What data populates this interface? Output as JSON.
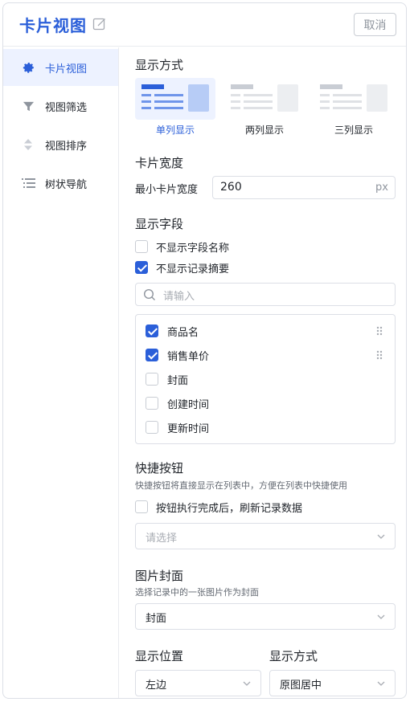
{
  "header": {
    "title": "卡片视图",
    "cancel_label": "取消"
  },
  "sidebar": {
    "items": [
      {
        "label": "卡片视图",
        "icon": "gear-icon",
        "active": true
      },
      {
        "label": "视图筛选",
        "icon": "filter-icon",
        "active": false
      },
      {
        "label": "视图排序",
        "icon": "sort-icon",
        "active": false
      },
      {
        "label": "树状导航",
        "icon": "tree-list-icon",
        "active": false
      }
    ]
  },
  "display_mode": {
    "title": "显示方式",
    "options": [
      {
        "label": "单列显示",
        "selected": true
      },
      {
        "label": "两列显示",
        "selected": false
      },
      {
        "label": "三列显示",
        "selected": false
      }
    ]
  },
  "card_width": {
    "title": "卡片宽度",
    "label": "最小卡片宽度",
    "value": "260",
    "unit": "px"
  },
  "fields": {
    "title": "显示字段",
    "hide_field_name": {
      "label": "不显示字段名称",
      "checked": false
    },
    "hide_summary": {
      "label": "不显示记录摘要",
      "checked": true
    },
    "search_placeholder": "请输入",
    "items": [
      {
        "label": "商品名",
        "checked": true
      },
      {
        "label": "销售单价",
        "checked": true
      },
      {
        "label": "封面",
        "checked": false
      },
      {
        "label": "创建时间",
        "checked": false
      },
      {
        "label": "更新时间",
        "checked": false
      }
    ]
  },
  "quick_buttons": {
    "title": "快捷按钮",
    "hint": "快捷按钮将直接显示在列表中，方便在列表中快捷使用",
    "refresh": {
      "label": "按钮执行完成后，刷新记录数据",
      "checked": false
    },
    "select_placeholder": "请选择"
  },
  "cover": {
    "title": "图片封面",
    "hint": "选择记录中的一张图片作为封面",
    "value": "封面",
    "position_label": "显示位置",
    "position_value": "左边",
    "mode_label": "显示方式",
    "mode_value": "原图居中"
  },
  "colors": {
    "accent": "#2b5fd9",
    "accent_bg": "#edf2ff",
    "border": "#dcdfe6"
  }
}
